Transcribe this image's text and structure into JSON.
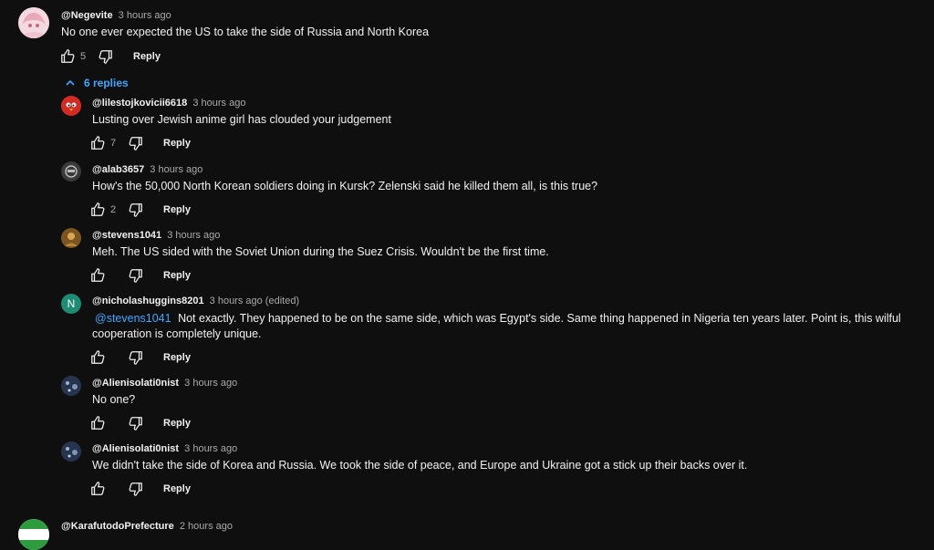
{
  "top_comment": {
    "author": "@Negevite",
    "time": "3 hours ago",
    "text": "No one ever expected the US to take the side of Russia and North Korea",
    "likes": "5",
    "reply_label": "Reply"
  },
  "replies_toggle": {
    "label": "6 replies"
  },
  "replies": [
    {
      "author": "@lilestojkovicii6618",
      "time": "3 hours ago",
      "text": "Lusting over Jewish anime girl has clouded your judgement",
      "likes": "7",
      "reply_label": "Reply"
    },
    {
      "author": "@alab3657",
      "time": "3 hours ago",
      "text": "How's the 50,000 North Korean soldiers doing in Kursk?   Zelenski said he killed them all,  is this true?",
      "likes": "2",
      "reply_label": "Reply"
    },
    {
      "author": "@stevens1041",
      "time": "3 hours ago",
      "text": "Meh.  The US sided with the Soviet Union during the Suez Crisis.  Wouldn't be the first time.",
      "likes": "",
      "reply_label": "Reply"
    },
    {
      "author": "@nicholashuggins8201",
      "time": "3 hours ago (edited)",
      "mention": "@stevens1041",
      "text": "Not exactly. They happened to be on the same side, which was Egypt's side. Same thing happened in Nigeria ten years later. Point is, this wilful cooperation is completely unique.",
      "likes": "",
      "reply_label": "Reply",
      "avatar_letter": "N"
    },
    {
      "author": "@Alienisolati0nist",
      "time": "3 hours ago",
      "text": "No one?",
      "likes": "",
      "reply_label": "Reply"
    },
    {
      "author": "@Alienisolati0nist",
      "time": "3 hours ago",
      "text": "We didn't take the side of Korea and Russia. We took the side of peace, and Europe and Ukraine got a stick up their backs over it.",
      "likes": "",
      "reply_label": "Reply"
    }
  ],
  "next_comment": {
    "author": "@KarafutodoPrefecture",
    "time": "2 hours ago"
  },
  "icons": {
    "like": "thumbs-up-icon",
    "dislike": "thumbs-down-icon",
    "toggle": "chevron-up-icon"
  },
  "colors": {
    "background": "#0f0f0f",
    "link": "#3ea6ff",
    "secondary_text": "#aaaaaa"
  }
}
